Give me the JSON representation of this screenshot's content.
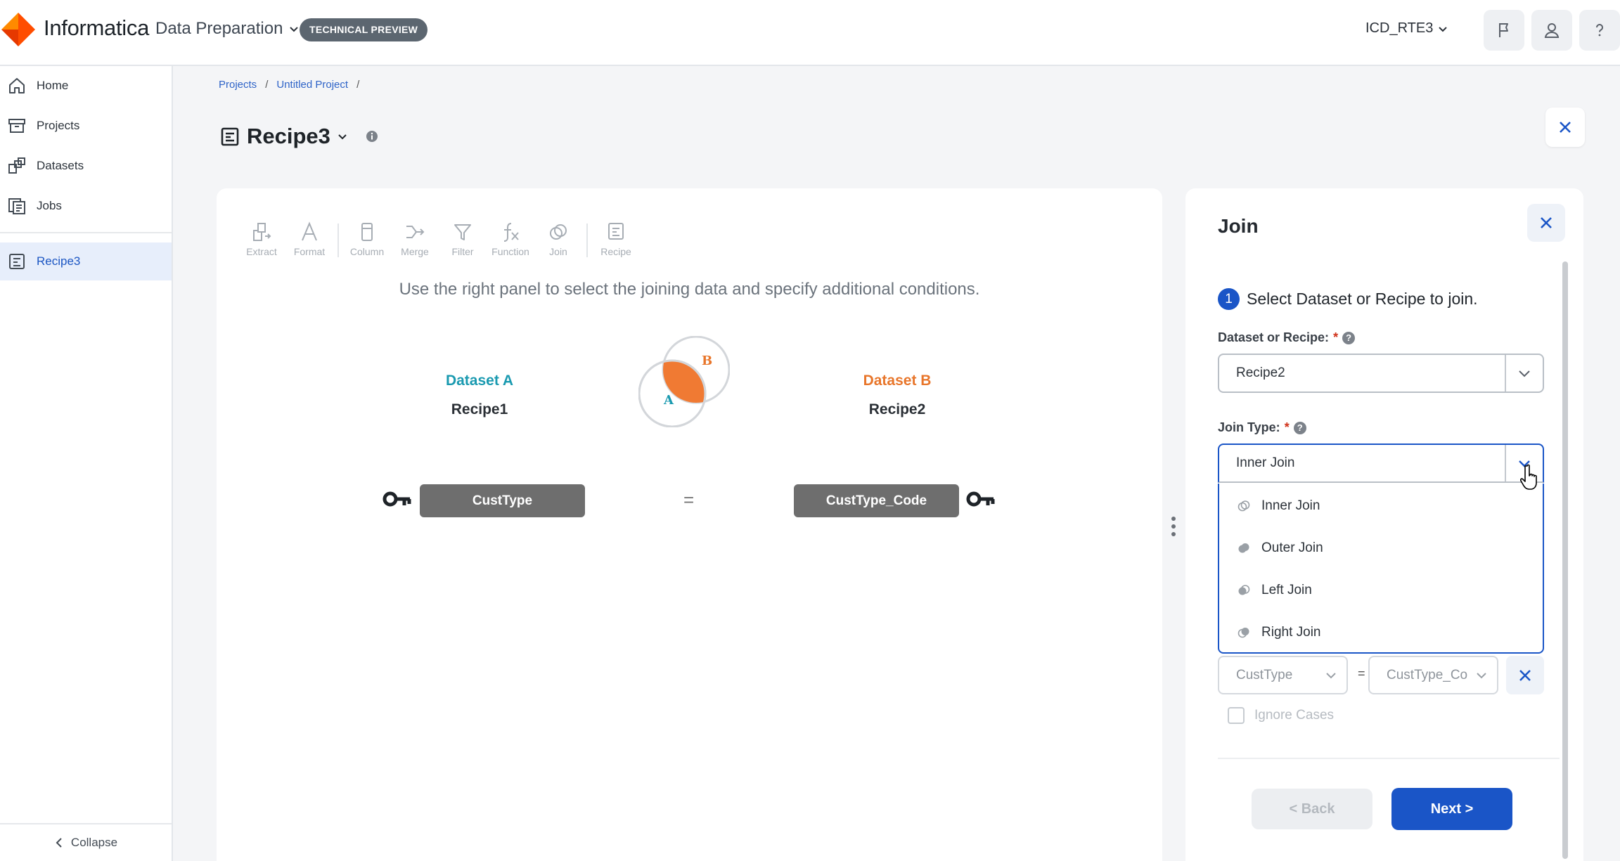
{
  "header": {
    "brand": "Informatica",
    "product": "Data Preparation",
    "badge": "TECHNICAL PREVIEW",
    "org": "ICD_RTE3"
  },
  "sidebar": {
    "items": [
      {
        "label": "Home",
        "icon": "home-icon"
      },
      {
        "label": "Projects",
        "icon": "archive-icon"
      },
      {
        "label": "Datasets",
        "icon": "datasets-icon"
      },
      {
        "label": "Jobs",
        "icon": "jobs-icon"
      }
    ],
    "active_item": {
      "label": "Recipe3",
      "icon": "recipe-icon"
    },
    "collapse_label": "Collapse"
  },
  "breadcrumb": [
    "Projects",
    "Untitled Project"
  ],
  "page": {
    "title": "Recipe3"
  },
  "toolbar": {
    "tools": [
      "Extract",
      "Format",
      "Column",
      "Merge",
      "Filter",
      "Function",
      "Join",
      "Recipe"
    ]
  },
  "canvas": {
    "hint": "Use the right panel to select the joining data and specify additional conditions.",
    "dataset_a_label": "Dataset A",
    "dataset_a_name": "Recipe1",
    "dataset_b_label": "Dataset B",
    "dataset_b_name": "Recipe2",
    "venn_a": "A",
    "venn_b": "B",
    "key_a": "CustType",
    "key_b": "CustType_Code",
    "equals": "=",
    "color_a": "#1a9ab0",
    "color_b": "#e8762b"
  },
  "panel": {
    "title": "Join",
    "step_number": "1",
    "step_text": "Select Dataset or Recipe to join.",
    "dataset_label": "Dataset or Recipe:",
    "dataset_value": "Recipe2",
    "join_type_label": "Join Type:",
    "join_type_value": "Inner Join",
    "required_mark": "*",
    "help_glyph": "?",
    "join_options": [
      "Inner Join",
      "Outer Join",
      "Left Join",
      "Right Join"
    ],
    "condition_left": "CustType",
    "condition_right": "CustType_Co",
    "condition_equals": "=",
    "ignore_cases_label": "Ignore Cases",
    "back_label": "<  Back",
    "next_label": "Next >"
  }
}
